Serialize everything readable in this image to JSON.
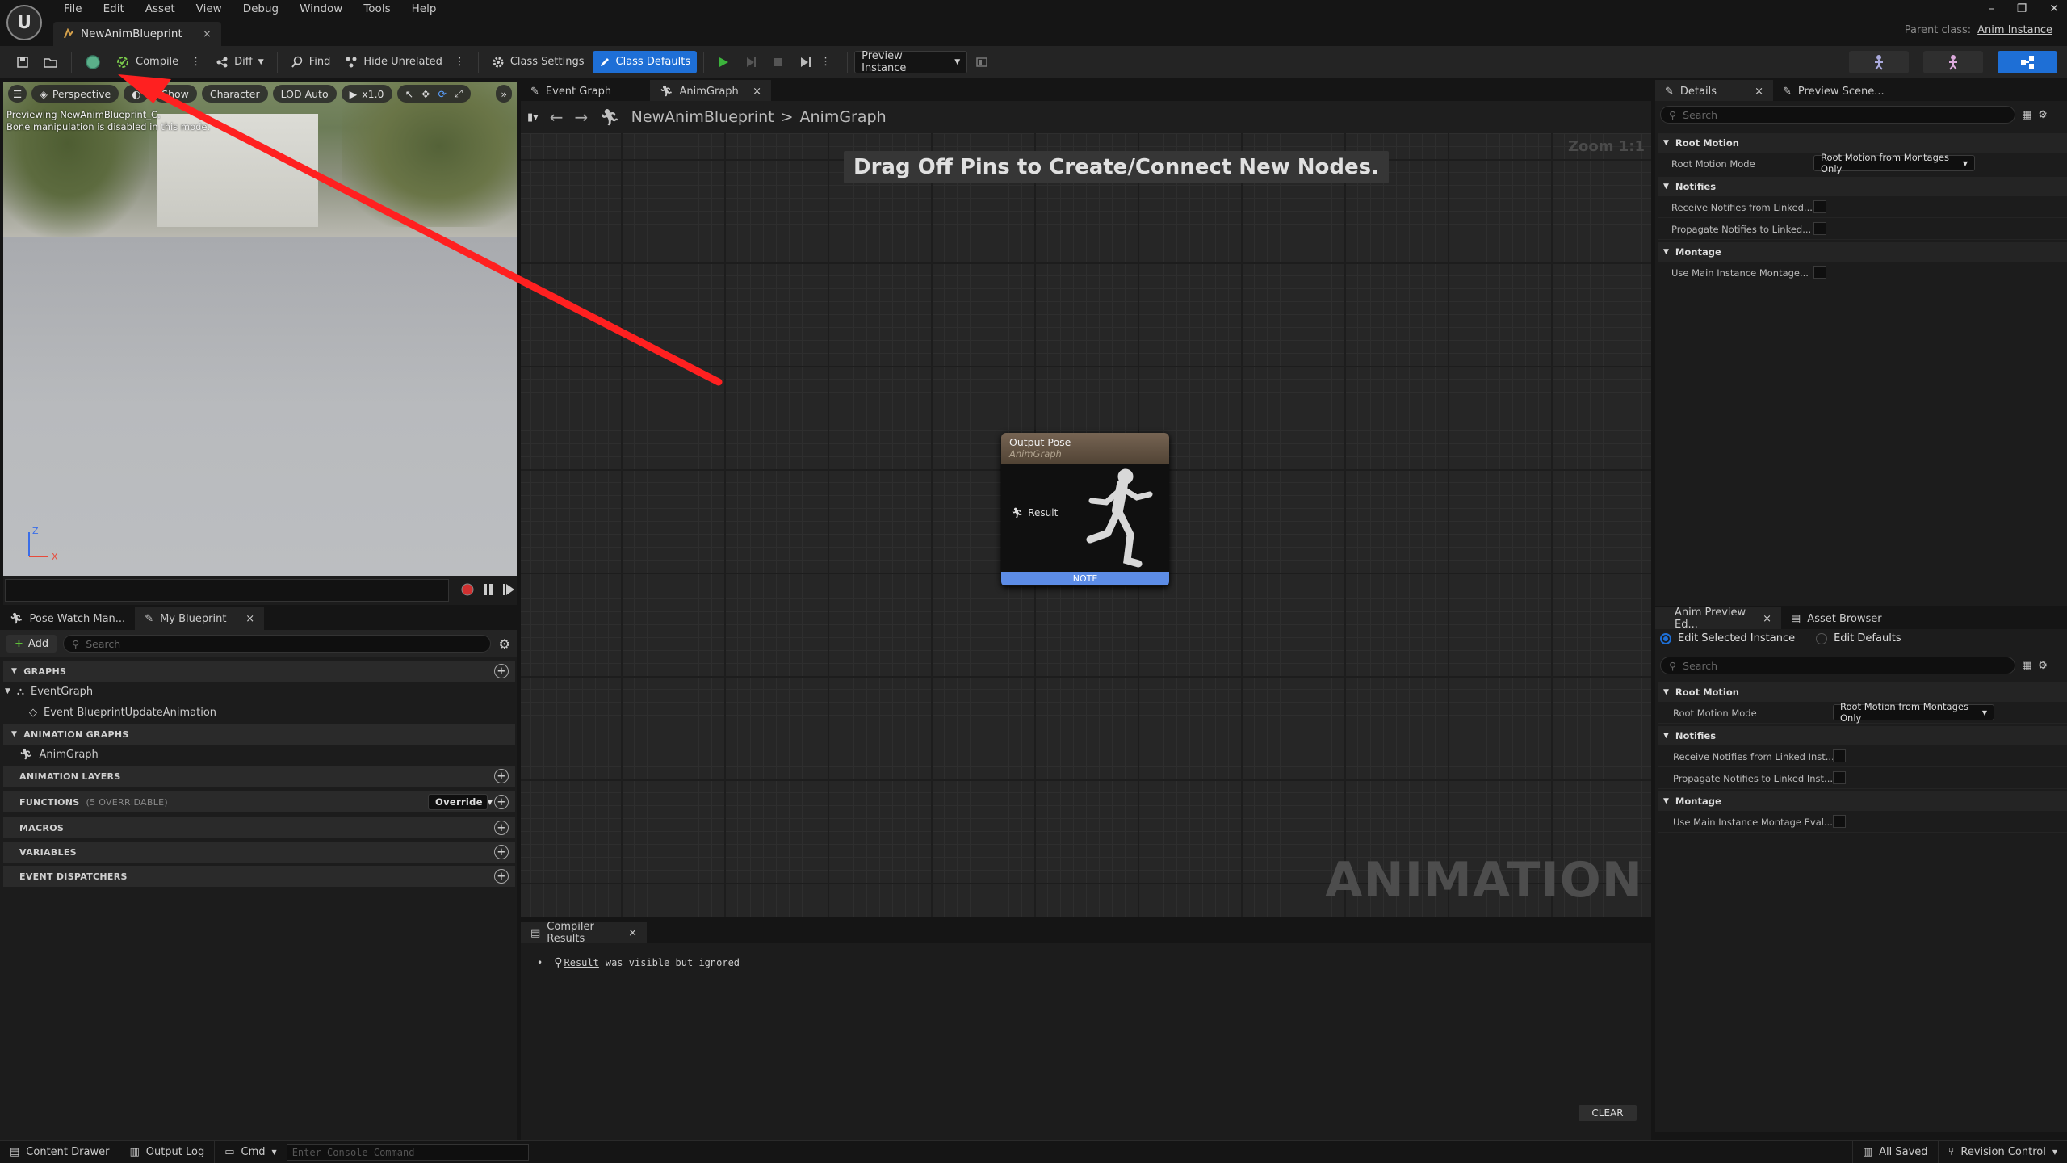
{
  "menu": [
    "File",
    "Edit",
    "Asset",
    "View",
    "Debug",
    "Window",
    "Tools",
    "Help"
  ],
  "asset_tab": {
    "label": "NewAnimBlueprint",
    "close": "×"
  },
  "window_controls": [
    "–",
    "❐",
    "✕"
  ],
  "parent_class": {
    "label": "Parent class:",
    "value": "Anim Instance"
  },
  "toolbar": {
    "compile": "Compile",
    "diff": "Diff",
    "find": "Find",
    "hide_unrelated": "Hide Unrelated",
    "class_settings": "Class Settings",
    "class_defaults": "Class Defaults",
    "preview_instance": "Preview Instance"
  },
  "viewport": {
    "perspective": "Perspective",
    "show": "Show",
    "character": "Character",
    "lod": "LOD Auto",
    "speed": "x1.0",
    "info_line1": "Previewing NewAnimBlueprint_C.",
    "info_line2": "Bone manipulation is disabled in this mode.",
    "axis_z": "Z",
    "axis_x": "X"
  },
  "left_tabs": {
    "pose_watch": "Pose Watch Man...",
    "my_blueprint": "My Blueprint",
    "close": "×"
  },
  "my_blueprint": {
    "add": "Add",
    "search_placeholder": "Search",
    "graphs": "GRAPHS",
    "event_graph": "EventGraph",
    "event_update": "Event BlueprintUpdateAnimation",
    "anim_graphs": "ANIMATION GRAPHS",
    "anim_graph": "AnimGraph",
    "anim_layers": "ANIMATION LAYERS",
    "functions": "FUNCTIONS",
    "functions_note": "(5 OVERRIDABLE)",
    "override": "Override",
    "macros": "MACROS",
    "variables": "VARIABLES",
    "event_dispatchers": "EVENT DISPATCHERS"
  },
  "graph_tabs": {
    "event_graph": "Event Graph",
    "anim_graph": "AnimGraph",
    "close": "×"
  },
  "breadcrumb": {
    "root": "NewAnimBlueprint",
    "sep": ">",
    "current": "AnimGraph"
  },
  "graph": {
    "zoom": "Zoom 1:1",
    "hint": "Drag Off Pins to Create/Connect New Nodes.",
    "watermark": "ANIMATION",
    "node_title": "Output Pose",
    "node_subtitle": "AnimGraph",
    "node_pin": "Result",
    "node_note": "NOTE"
  },
  "compiler": {
    "tab": "Compiler Results",
    "close": "×",
    "result_link": "Result",
    "result_text": "was visible but ignored",
    "clear": "CLEAR"
  },
  "details_tabs": {
    "details": "Details",
    "preview_scene": "Preview Scene...",
    "close": "×"
  },
  "details": {
    "search_placeholder": "Search",
    "cat_root_motion": "Root Motion",
    "root_motion_mode": "Root Motion Mode",
    "root_motion_value": "Root Motion from Montages Only",
    "cat_notifies": "Notifies",
    "receive_notifies": "Receive Notifies from Linked...",
    "propagate_notifies": "Propagate Notifies to Linked...",
    "cat_montage": "Montage",
    "use_main_montage": "Use Main Instance Montage..."
  },
  "apd_tabs": {
    "anim_preview": "Anim Preview Ed...",
    "asset_browser": "Asset Browser",
    "close": "×"
  },
  "apd": {
    "edit_selected": "Edit Selected Instance",
    "edit_defaults": "Edit Defaults",
    "search_placeholder": "Search",
    "cat_root_motion": "Root Motion",
    "root_motion_mode": "Root Motion Mode",
    "root_motion_value": "Root Motion from Montages Only",
    "cat_notifies": "Notifies",
    "receive_notifies": "Receive Notifies from Linked Inst...",
    "propagate_notifies": "Propagate Notifies to Linked Inst...",
    "cat_montage": "Montage",
    "use_main_montage": "Use Main Instance Montage Eval..."
  },
  "statusbar": {
    "content_drawer": "Content Drawer",
    "output_log": "Output Log",
    "cmd": "Cmd",
    "console_placeholder": "Enter Console Command",
    "all_saved": "All Saved",
    "revision_control": "Revision Control"
  },
  "colors": {
    "accent": "#1e6fd6",
    "annotation_arrow": "#ff2020",
    "node_note": "#5c8ce6"
  }
}
